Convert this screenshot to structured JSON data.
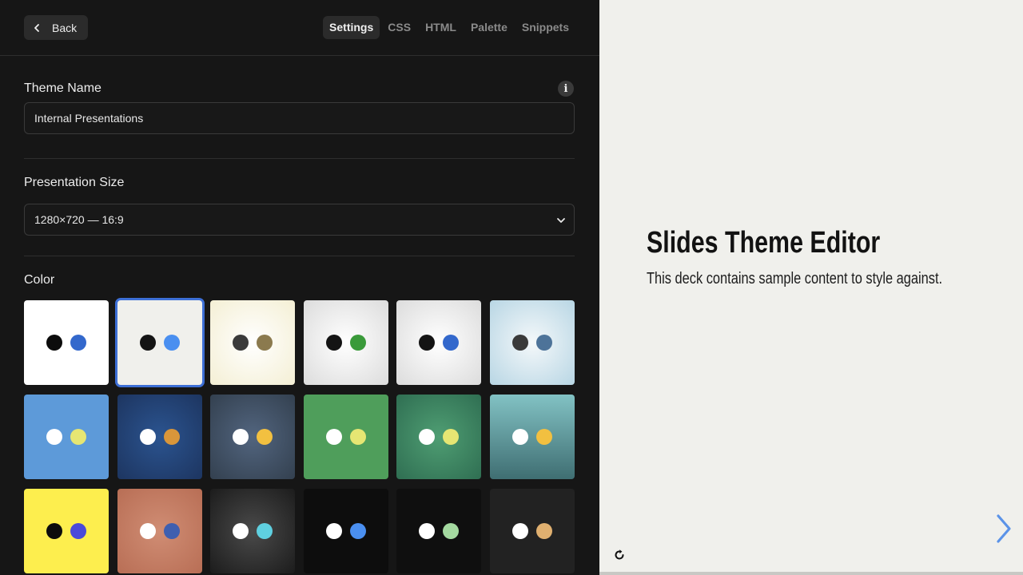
{
  "header": {
    "back_label": "Back",
    "tabs": [
      {
        "label": "Settings",
        "active": true
      },
      {
        "label": "CSS",
        "active": false
      },
      {
        "label": "HTML",
        "active": false
      },
      {
        "label": "Palette",
        "active": false
      },
      {
        "label": "Snippets",
        "active": false
      }
    ]
  },
  "settings": {
    "theme_name": {
      "label": "Theme Name",
      "value": "Internal Presentations",
      "info_icon": "info-icon"
    },
    "presentation_size": {
      "label": "Presentation Size",
      "selected": "1280×720 — 16:9"
    },
    "color": {
      "label": "Color",
      "swatches": [
        {
          "bg": "#ffffff",
          "dots": [
            "#0c0c0c",
            "#3368cc"
          ],
          "selected": false
        },
        {
          "bg": "#f0f0ec",
          "dots": [
            "#141414",
            "#4a8ff0"
          ],
          "selected": true
        },
        {
          "bg": "radial-gradient(circle at 50% 50%, #ffffff 0%, #f4efd4 100%)",
          "dots": [
            "#3a3a3a",
            "#8b7a4e"
          ],
          "selected": false
        },
        {
          "bg": "radial-gradient(circle at 50% 50%, #ffffff 0%, #dcdcdc 100%)",
          "dots": [
            "#141414",
            "#3a9a3a"
          ],
          "selected": false
        },
        {
          "bg": "radial-gradient(circle at 50% 50%, #ffffff 0%, #dcdcdc 100%)",
          "dots": [
            "#141414",
            "#3368cc"
          ],
          "selected": false
        },
        {
          "bg": "radial-gradient(circle at 50% 50%, #f4f8fa 0%, #b8d6e4 100%)",
          "dots": [
            "#3a3a3a",
            "#4d7399"
          ],
          "selected": false
        },
        {
          "bg": "#5d9ad9",
          "dots": [
            "#ffffff",
            "#e6e673"
          ],
          "selected": false
        },
        {
          "bg": "radial-gradient(circle at 50% 50%, #2b5490 0%, #1d3560 100%)",
          "dots": [
            "#ffffff",
            "#d9963a"
          ],
          "selected": false
        },
        {
          "bg": "radial-gradient(circle at 50% 50%, #52657f 0%, #33404f 100%)",
          "dots": [
            "#ffffff",
            "#f2c040"
          ],
          "selected": false
        },
        {
          "bg": "#4f9e5b",
          "dots": [
            "#ffffff",
            "#e6e673"
          ],
          "selected": false
        },
        {
          "bg": "radial-gradient(circle at 50% 50%, #4f9e73 0%, #2f6e52 100%)",
          "dots": [
            "#ffffff",
            "#e6e673"
          ],
          "selected": false
        },
        {
          "bg": "linear-gradient(180deg, #82c2c4 0%, #3f6e72 100%)",
          "dots": [
            "#ffffff",
            "#f2c040"
          ],
          "selected": false
        },
        {
          "bg": "#fdee4e",
          "dots": [
            "#0c0c0c",
            "#4a4ad9"
          ],
          "selected": false
        },
        {
          "bg": "radial-gradient(circle at 50% 50%, #d08d74 0%, #b86e55 100%)",
          "dots": [
            "#ffffff",
            "#3e5fb0"
          ],
          "selected": false
        },
        {
          "bg": "radial-gradient(circle at 50% 50%, #4a4a4a 0%, #1c1c1c 100%)",
          "dots": [
            "#ffffff",
            "#5fd0e0"
          ],
          "selected": false
        },
        {
          "bg": "#0d0d0d",
          "dots": [
            "#ffffff",
            "#4a8ff0"
          ],
          "selected": false
        },
        {
          "bg": "#0f0f0f",
          "dots": [
            "#ffffff",
            "#a4d9a0"
          ],
          "selected": false
        },
        {
          "bg": "#222222",
          "dots": [
            "#ffffff",
            "#e0b070"
          ],
          "selected": false
        }
      ]
    }
  },
  "preview": {
    "title": "Slides Theme Editor",
    "subtitle": "This deck contains sample content to style against.",
    "next_icon": "chevron-right-icon",
    "refresh_icon": "refresh-icon"
  },
  "colors": {
    "accent": "#3d6fd6",
    "panel_bg": "#161616",
    "preview_bg": "#f0f0ec"
  }
}
